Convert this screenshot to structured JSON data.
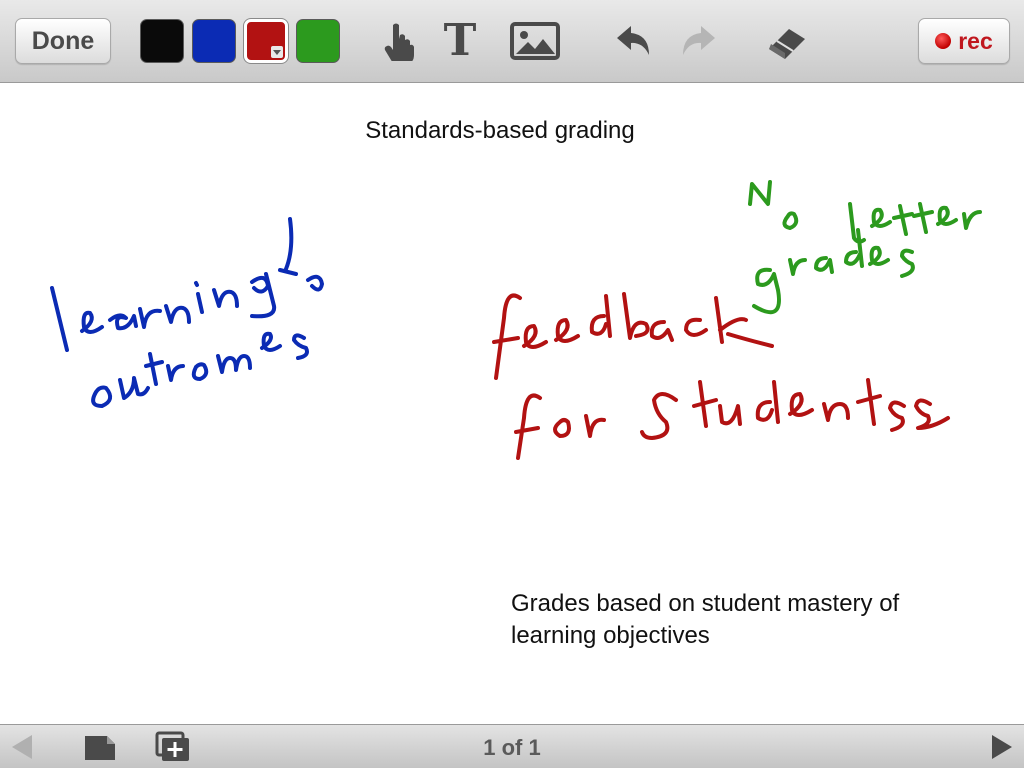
{
  "toolbar": {
    "done_label": "Done",
    "rec_label": "rec",
    "text_tool_glyph": "T",
    "colors": {
      "black": "#0a0a0a",
      "blue": "#0b2bb4",
      "red": "#b21212",
      "green": "#2c9a1e"
    },
    "selected_color": "red",
    "icons": [
      "pointer-hand-icon",
      "text-tool-icon",
      "image-icon",
      "undo-icon",
      "redo-icon",
      "eraser-icon"
    ]
  },
  "canvas": {
    "title": "Standards-based grading",
    "body_text_line1": "Grades based on student mastery of",
    "body_text_line2": "learning objectives",
    "handwriting": {
      "blue_text": "learning outcomes",
      "green_text": "No letter grades",
      "red_text": "feedback for students"
    }
  },
  "bottombar": {
    "page_indicator": "1 of 1",
    "icons": [
      "prev-page-icon",
      "page-icon",
      "add-page-icon",
      "next-page-icon"
    ]
  }
}
